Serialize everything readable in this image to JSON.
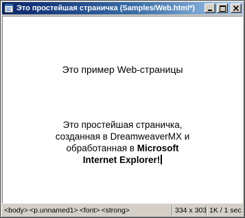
{
  "window": {
    "title": "Это простейшая страничка (Samples/Web.html*)"
  },
  "document": {
    "heading": "Это пример Web-страницы",
    "paragraph_lines": [
      "Это простейшая страничка,",
      "созданная в DreamweaverMX и",
      "обработанная в "
    ],
    "bold_line_1": "Microsoft",
    "bold_line_2": "Internet Explorer!"
  },
  "statusbar": {
    "tags": [
      "<body>",
      "<p.unnamed1>",
      "<font>",
      "<strong>"
    ],
    "window_size": "334 x 303",
    "download_stats": "1K / 1 sec"
  },
  "icons": {
    "app": "dreamweaver-doc-icon",
    "minimize": "minimize-icon",
    "maximize": "maximize-icon",
    "close": "close-icon",
    "dropdown": "chevron-down-icon"
  }
}
